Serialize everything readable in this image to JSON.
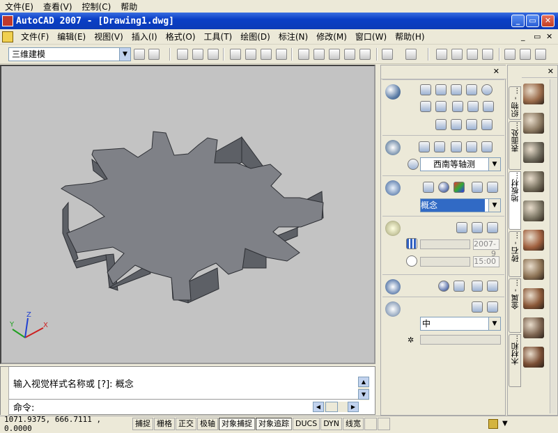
{
  "outer_menu": [
    "文件(E)",
    "查看(V)",
    "控制(C)",
    "帮助"
  ],
  "window": {
    "title": "AutoCAD 2007 - [Drawing1.dwg]",
    "min": "_",
    "max": "▭",
    "close": "✕"
  },
  "menubar": [
    "文件(F)",
    "编辑(E)",
    "视图(V)",
    "插入(I)",
    "格式(O)",
    "工具(T)",
    "绘图(D)",
    "标注(N)",
    "修改(M)",
    "窗口(W)",
    "帮助(H)"
  ],
  "toolbar": {
    "workspace": "三维建模"
  },
  "viewport": {
    "ucs_labels": {
      "x": "X",
      "y": "Y",
      "z": "Z"
    },
    "background": "#c3c3c3",
    "gear_top": "#7f8187",
    "gear_side": "#5d6066"
  },
  "command": {
    "history": "输入视觉样式名称或 [?]: 概念",
    "prompt": "命令:"
  },
  "status": {
    "coordinates": "1071.9375, 666.7111 , 0.0000",
    "toggles": [
      {
        "label": "捕捉",
        "on": false
      },
      {
        "label": "栅格",
        "on": false
      },
      {
        "label": "正交",
        "on": false
      },
      {
        "label": "极轴",
        "on": false
      },
      {
        "label": "对象捕捉",
        "on": true
      },
      {
        "label": "对象追踪",
        "on": true
      },
      {
        "label": "DUCS",
        "on": false
      },
      {
        "label": "DYN",
        "on": false
      },
      {
        "label": "线宽",
        "on": false
      }
    ]
  },
  "dashboard": {
    "view_combo": "西南等轴测",
    "visual_style_combo": "概念",
    "date_value": "2007-9",
    "time_value": "15:00",
    "material_combo": "中"
  },
  "tool_palette": {
    "tabs": [
      "织物 - ...",
      "表面处...",
      "地板材...",
      "砖石 - ...",
      "金属 - ...",
      "木材和..."
    ],
    "swatch_colors": [
      "#9a6b4a",
      "#8c7a62",
      "#6e6a5c",
      "#77705e",
      "#7c7664",
      "#a0603f",
      "#8e7456",
      "#8a5838",
      "#7d6450",
      "#7a4e34"
    ]
  }
}
